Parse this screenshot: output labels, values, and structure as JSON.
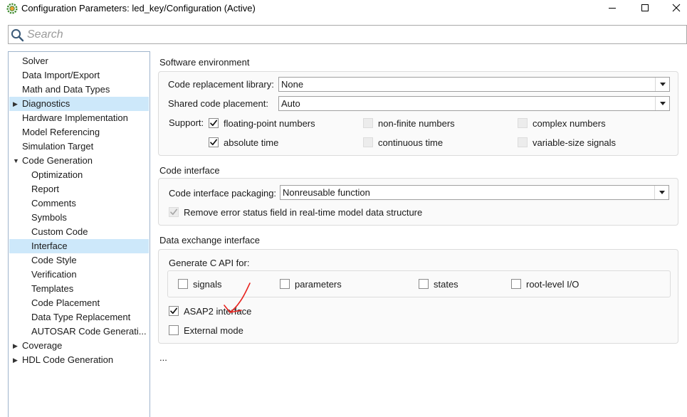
{
  "window": {
    "title": "Configuration Parameters: led_key/Configuration (Active)",
    "icon": "simulink-gear-icon",
    "controls": [
      "minimize",
      "maximize",
      "close"
    ]
  },
  "search": {
    "placeholder": "Search",
    "value": ""
  },
  "tree": {
    "items": [
      {
        "label": "Solver",
        "level": 0,
        "expander": "",
        "selected": false
      },
      {
        "label": "Data Import/Export",
        "level": 0,
        "expander": "",
        "selected": false
      },
      {
        "label": "Math and Data Types",
        "level": 0,
        "expander": "",
        "selected": false
      },
      {
        "label": "Diagnostics",
        "level": 0,
        "expander": "collapsed",
        "selected": false,
        "highlighted": true
      },
      {
        "label": "Hardware Implementation",
        "level": 0,
        "expander": "",
        "selected": false
      },
      {
        "label": "Model Referencing",
        "level": 0,
        "expander": "",
        "selected": false
      },
      {
        "label": "Simulation Target",
        "level": 0,
        "expander": "",
        "selected": false
      },
      {
        "label": "Code Generation",
        "level": 0,
        "expander": "expanded",
        "selected": false
      },
      {
        "label": "Optimization",
        "level": 1,
        "expander": "",
        "selected": false
      },
      {
        "label": "Report",
        "level": 1,
        "expander": "",
        "selected": false
      },
      {
        "label": "Comments",
        "level": 1,
        "expander": "",
        "selected": false
      },
      {
        "label": "Symbols",
        "level": 1,
        "expander": "",
        "selected": false
      },
      {
        "label": "Custom Code",
        "level": 1,
        "expander": "",
        "selected": false
      },
      {
        "label": "Interface",
        "level": 1,
        "expander": "",
        "selected": true
      },
      {
        "label": "Code Style",
        "level": 1,
        "expander": "",
        "selected": false
      },
      {
        "label": "Verification",
        "level": 1,
        "expander": "",
        "selected": false
      },
      {
        "label": "Templates",
        "level": 1,
        "expander": "",
        "selected": false
      },
      {
        "label": "Code Placement",
        "level": 1,
        "expander": "",
        "selected": false
      },
      {
        "label": "Data Type Replacement",
        "level": 1,
        "expander": "",
        "selected": false
      },
      {
        "label": "AUTOSAR Code Generati...",
        "level": 1,
        "expander": "",
        "selected": false
      },
      {
        "label": "Coverage",
        "level": 0,
        "expander": "collapsed",
        "selected": false
      },
      {
        "label": "HDL Code Generation",
        "level": 0,
        "expander": "collapsed",
        "selected": false
      }
    ]
  },
  "software_env": {
    "title": "Software environment",
    "crl_label": "Code replacement library:",
    "crl_value": "None",
    "placement_label": "Shared code placement:",
    "placement_value": "Auto",
    "support_label": "Support:",
    "support": [
      {
        "label": "floating-point numbers",
        "checked": true,
        "enabled": true
      },
      {
        "label": "non-finite numbers",
        "checked": false,
        "enabled": false
      },
      {
        "label": "complex numbers",
        "checked": false,
        "enabled": false
      },
      {
        "label": "absolute time",
        "checked": true,
        "enabled": true
      },
      {
        "label": "continuous time",
        "checked": false,
        "enabled": false
      },
      {
        "label": "variable-size signals",
        "checked": false,
        "enabled": false
      }
    ]
  },
  "code_interface": {
    "title": "Code interface",
    "packaging_label": "Code interface packaging:",
    "packaging_value": "Nonreusable function",
    "remove_error_label": "Remove error status field in real-time model data structure",
    "remove_error_checked": true,
    "remove_error_enabled": false
  },
  "data_exchange": {
    "title": "Data exchange interface",
    "capi_label": "Generate C API for:",
    "capi": [
      {
        "label": "signals",
        "checked": false
      },
      {
        "label": "parameters",
        "checked": false
      },
      {
        "label": "states",
        "checked": false
      },
      {
        "label": "root-level I/O",
        "checked": false
      }
    ],
    "asap2_label": "ASAP2 interface",
    "asap2_checked": true,
    "external_label": "External mode",
    "external_checked": false
  },
  "more": "...",
  "colors": {
    "selection": "#cde8fa",
    "tree_border": "#9fb4cc",
    "annotation": "#e8231f"
  }
}
